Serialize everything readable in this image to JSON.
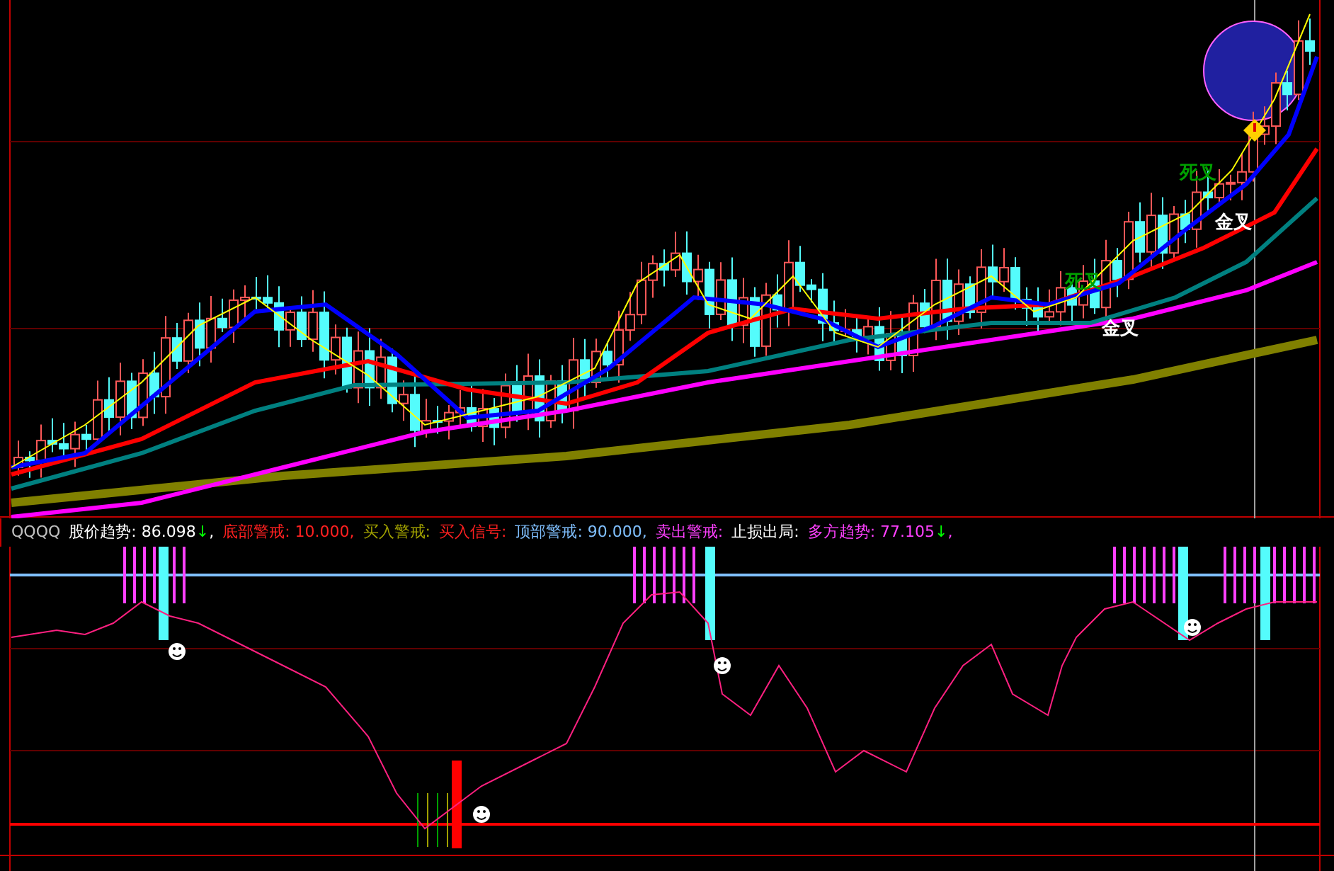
{
  "price_chart": {
    "annotations": [
      {
        "text": "死叉",
        "color": "#00a000"
      },
      {
        "text": "金叉",
        "color": "#ffffff"
      },
      {
        "text": "死叉",
        "color": "#00a000"
      },
      {
        "text": "金叉",
        "color": "#ffffff"
      }
    ]
  },
  "legend": [
    {
      "text": "QQQQ",
      "color": "#c0c0c0"
    },
    {
      "text": "股价趋势: 86.098",
      "color": "#ffffff",
      "arrow": "↓",
      "tail": ","
    },
    {
      "text": "底部警戒: 10.000,",
      "color": "#ff2020"
    },
    {
      "text": "买入警戒:",
      "color": "#a0a000"
    },
    {
      "text": "买入信号:",
      "color": "#ff2020"
    },
    {
      "text": "顶部警戒: 90.000,",
      "color": "#80c0ff"
    },
    {
      "text": "卖出警戒:",
      "color": "#ff40ff"
    },
    {
      "text": "止损出局:",
      "color": "#ffffff"
    },
    {
      "text": "多方趋势: 77.105",
      "color": "#ff40ff",
      "arrow": "↓",
      "tail": ","
    }
  ]
}
